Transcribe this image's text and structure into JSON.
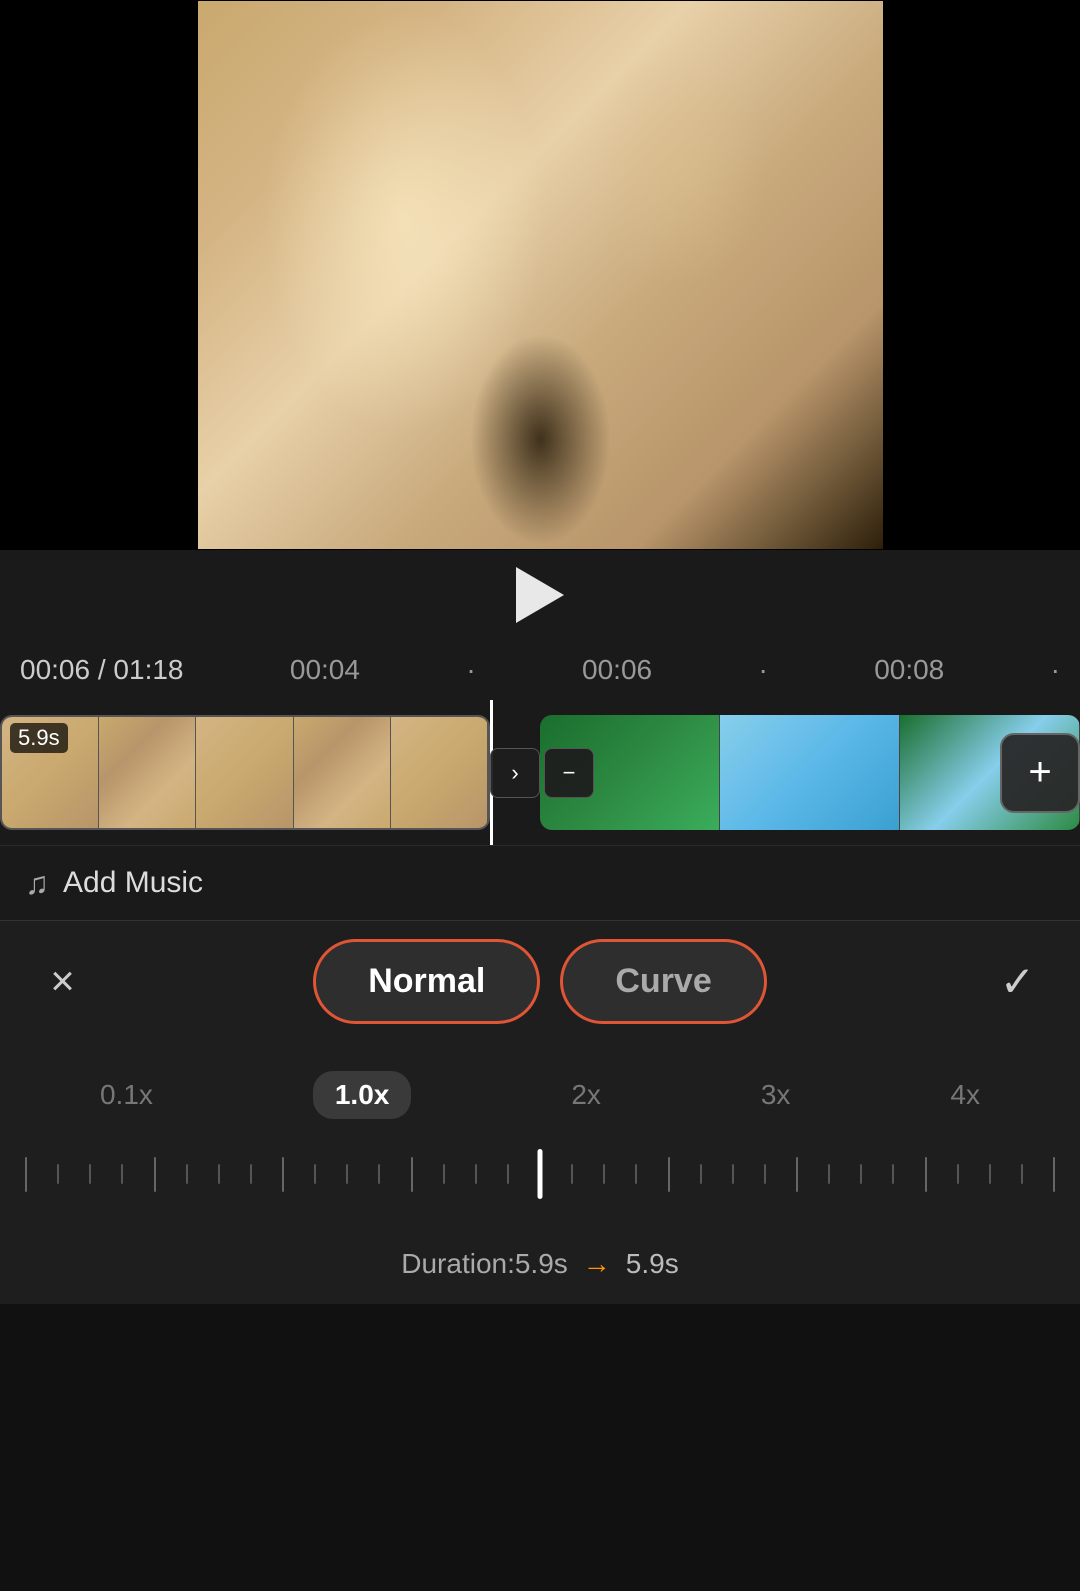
{
  "video": {
    "current_time": "00:06",
    "total_time": "01:18"
  },
  "timeline": {
    "markers": [
      "00:04",
      "00:06",
      "00:08"
    ],
    "dot_marker": "·"
  },
  "clip1": {
    "duration": "5.9s"
  },
  "add_music_label": "Add Music",
  "mode_tabs": {
    "normal_label": "Normal",
    "curve_label": "Curve"
  },
  "speed": {
    "labels": [
      "0.1x",
      "1.0x",
      "2x",
      "3x",
      "4x"
    ],
    "active": "1.0x"
  },
  "duration": {
    "label": "Duration:5.9s",
    "arrow": "→",
    "value": "5.9s"
  },
  "buttons": {
    "close": "×",
    "confirm": "✓",
    "play": "▶"
  },
  "transition": {
    "forward": "›",
    "minus": "−"
  },
  "add_clip": "+"
}
